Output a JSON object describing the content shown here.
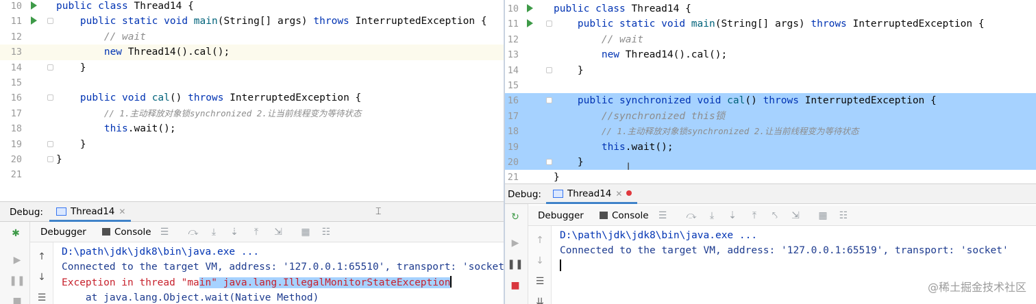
{
  "left": {
    "code_lines": [
      {
        "num": "10",
        "run": true,
        "fold": false,
        "parts": [
          [
            "kw",
            "public class "
          ],
          [
            "plain",
            "Thread14 {"
          ]
        ]
      },
      {
        "num": "11",
        "run": true,
        "fold": true,
        "parts": [
          [
            "plain",
            "    "
          ],
          [
            "kw",
            "public static void "
          ],
          [
            "fn",
            "main"
          ],
          [
            "plain",
            "(String[] args) "
          ],
          [
            "kw",
            "throws "
          ],
          [
            "plain",
            "InterruptedException {"
          ]
        ]
      },
      {
        "num": "12",
        "run": false,
        "fold": false,
        "parts": [
          [
            "plain",
            "        "
          ],
          [
            "cmt",
            "// wait"
          ]
        ]
      },
      {
        "num": "13",
        "run": false,
        "fold": false,
        "current": true,
        "parts": [
          [
            "plain",
            "        "
          ],
          [
            "kw",
            "new "
          ],
          [
            "plain",
            "Thread14().cal();"
          ]
        ]
      },
      {
        "num": "14",
        "run": false,
        "fold": true,
        "parts": [
          [
            "plain",
            "    }"
          ]
        ]
      },
      {
        "num": "15",
        "run": false,
        "fold": false,
        "parts": []
      },
      {
        "num": "16",
        "run": false,
        "fold": true,
        "parts": [
          [
            "plain",
            "    "
          ],
          [
            "kw",
            "public void "
          ],
          [
            "fn",
            "cal"
          ],
          [
            "plain",
            "() "
          ],
          [
            "kw",
            "throws "
          ],
          [
            "plain",
            "InterruptedException {"
          ]
        ]
      },
      {
        "num": "17",
        "run": false,
        "fold": false,
        "parts": [
          [
            "plain",
            "        "
          ],
          [
            "cmt",
            "// 1.主动释放对象锁synchronized 2.让当前线程变为等待状态"
          ]
        ]
      },
      {
        "num": "18",
        "run": false,
        "fold": false,
        "parts": [
          [
            "plain",
            "        "
          ],
          [
            "kw",
            "this"
          ],
          [
            "plain",
            ".wait();"
          ]
        ]
      },
      {
        "num": "19",
        "run": false,
        "fold": true,
        "parts": [
          [
            "plain",
            "    }"
          ]
        ]
      },
      {
        "num": "20",
        "run": false,
        "fold": true,
        "parts": [
          [
            "plain",
            "}"
          ]
        ]
      },
      {
        "num": "21",
        "run": false,
        "fold": false,
        "parts": []
      }
    ],
    "debug_label": "Debug:",
    "session_tab": "Thread14",
    "debugger_tab": "Debugger",
    "console_tab": "Console",
    "console": {
      "cmd": "D:\\path\\jdk\\jdk8\\bin\\java.exe ...",
      "connected": "Connected to the target VM, address: '127.0.0.1:65510', transport: 'socket'",
      "exception_prefix": "Exception in thread \"ma",
      "exception_selected": "in\" java.lang.IllegalMonitorStateException",
      "stack": "    at java.lang.Object.wait(Native Method)"
    }
  },
  "right": {
    "code_lines": [
      {
        "num": "10",
        "run": true,
        "fold": false,
        "parts": [
          [
            "kw",
            "public class "
          ],
          [
            "plain",
            "Thread14 {"
          ]
        ]
      },
      {
        "num": "11",
        "run": true,
        "fold": true,
        "parts": [
          [
            "plain",
            "    "
          ],
          [
            "kw",
            "public static void "
          ],
          [
            "fn",
            "main"
          ],
          [
            "plain",
            "(String[] args) "
          ],
          [
            "kw",
            "throws "
          ],
          [
            "plain",
            "InterruptedException {"
          ]
        ]
      },
      {
        "num": "12",
        "run": false,
        "fold": false,
        "parts": [
          [
            "plain",
            "        "
          ],
          [
            "cmt",
            "// wait"
          ]
        ]
      },
      {
        "num": "13",
        "run": false,
        "fold": false,
        "parts": [
          [
            "plain",
            "        "
          ],
          [
            "kw",
            "new "
          ],
          [
            "plain",
            "Thread14().cal();"
          ]
        ]
      },
      {
        "num": "14",
        "run": false,
        "fold": true,
        "parts": [
          [
            "plain",
            "    }"
          ]
        ]
      },
      {
        "num": "15",
        "run": false,
        "fold": false,
        "parts": []
      },
      {
        "num": "16",
        "run": false,
        "fold": true,
        "selected": true,
        "parts": [
          [
            "plain",
            "    "
          ],
          [
            "kw",
            "public synchronized void "
          ],
          [
            "fn",
            "cal"
          ],
          [
            "plain",
            "() "
          ],
          [
            "kw",
            "throws "
          ],
          [
            "plain",
            "InterruptedException {"
          ]
        ]
      },
      {
        "num": "17",
        "run": false,
        "fold": false,
        "selected": true,
        "parts": [
          [
            "plain",
            "        "
          ],
          [
            "cmt",
            "//synchronized this锁"
          ]
        ]
      },
      {
        "num": "18",
        "run": false,
        "fold": false,
        "selected": true,
        "parts": [
          [
            "plain",
            "        "
          ],
          [
            "cmt",
            "// 1.主动释放对象锁synchronized 2.让当前线程变为等待状态"
          ]
        ]
      },
      {
        "num": "19",
        "run": false,
        "fold": false,
        "selected": true,
        "parts": [
          [
            "plain",
            "        "
          ],
          [
            "kw",
            "this"
          ],
          [
            "plain",
            ".wait();"
          ]
        ]
      },
      {
        "num": "20",
        "run": false,
        "fold": true,
        "selected": true,
        "parts": [
          [
            "plain",
            "    }"
          ]
        ]
      },
      {
        "num": "21",
        "run": false,
        "fold": false,
        "parts": [
          [
            "plain",
            "}"
          ]
        ]
      }
    ],
    "debug_label": "Debug:",
    "session_tab": "Thread14",
    "debugger_tab": "Debugger",
    "console_tab": "Console",
    "console": {
      "cmd": "D:\\path\\jdk\\jdk8\\bin\\java.exe ...",
      "connected": "Connected to the target VM, address: '127.0.0.1:65519', transport: 'socket'"
    }
  },
  "watermark": "@稀土掘金技术社区",
  "icons": {
    "run": "run-gutter-icon",
    "fold": "fold-marker-icon",
    "bug": "debug-bug-icon",
    "rerun": "rerun-icon",
    "resume": "resume-icon",
    "pause": "pause-icon",
    "stop": "stop-icon",
    "up": "scroll-up-icon",
    "down": "scroll-down-icon",
    "close": "close-icon",
    "console": "console-icon"
  }
}
